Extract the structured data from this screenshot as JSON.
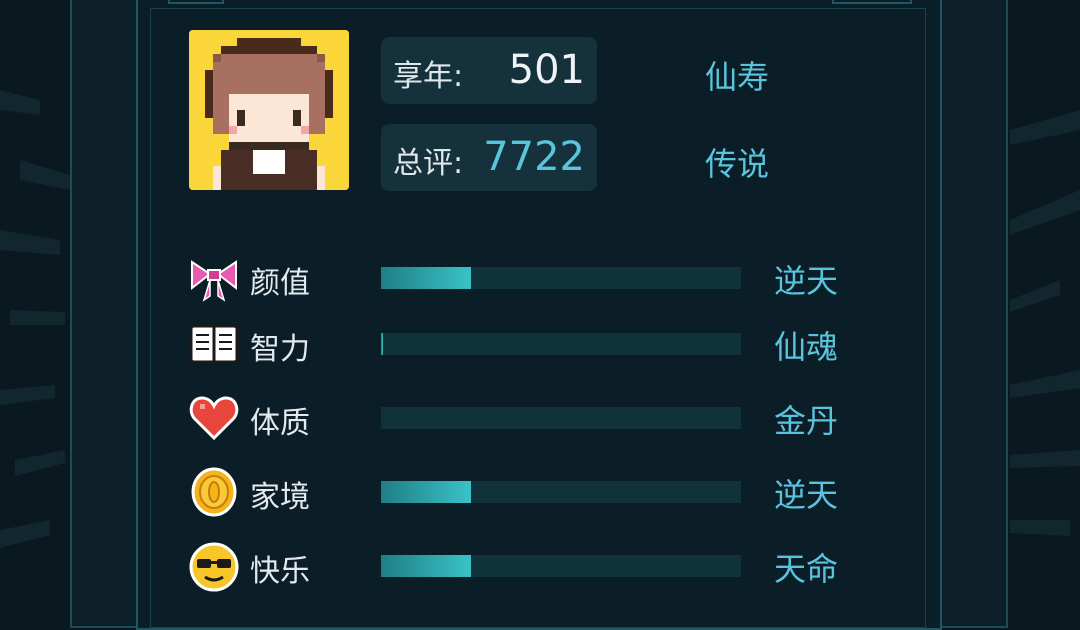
{
  "profile": {
    "age_label": "享年:",
    "age_value": "501",
    "age_grade": "仙寿",
    "score_label": "总评:",
    "score_value": "7722",
    "score_grade": "传说"
  },
  "attributes": [
    {
      "icon": "bow-icon",
      "label": "颜值",
      "grade": "逆天",
      "fill": 0.25
    },
    {
      "icon": "book-icon",
      "label": "智力",
      "grade": "仙魂",
      "fill": 0.005
    },
    {
      "icon": "heart-icon",
      "label": "体质",
      "grade": "金丹",
      "fill": 0.0
    },
    {
      "icon": "coin-icon",
      "label": "家境",
      "grade": "逆天",
      "fill": 0.25
    },
    {
      "icon": "sunglasses-face-icon",
      "label": "快乐",
      "grade": "天命",
      "fill": 0.25
    }
  ],
  "colors": {
    "accent": "#5ac4dd",
    "bar_fill": "#39c2c7",
    "avatar_bg": "#fbd63a"
  }
}
